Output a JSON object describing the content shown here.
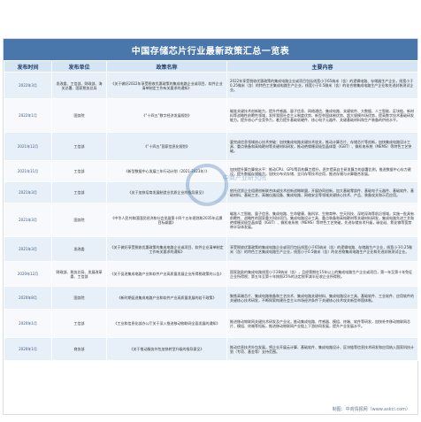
{
  "title": "中国存储芯片行业最新政策汇总一览表",
  "headers": [
    "发布时间",
    "发布单位",
    "政策名称",
    "主要内容"
  ],
  "rows": [
    {
      "time": "2022年3月",
      "unit": "发改委、工信部、财政部、海关总署、国家税务总局",
      "policy": "《关于做好2022年享受税收优惠政策的集成电路企业或项目、软件企业清单制定工作有关要求的通知》",
      "content": "2022年享受税收优惠政策的集成电路企业或项目包括线宽小于65纳米（含）的逻辑电路、存储器生产企业，线宽小于0.25微米（含）的特色工艺集成电路生产企业，线宽小于0.5微米（含）的化合物集成电路生产企业和先进封装测试企业。"
    },
    {
      "time": "2022年1月",
      "unit": "国务院",
      "policy": "《“十四五”数字经济发展规划》",
      "content": "瞄准关键技术创新能力，提升传感器、量子信息、网络通信、集成电路、关键软件、大数据、人工智能、区块链、新材料等战略性前瞻性领域，发挥我国社会主义制度优势、新型举国体制优势、超大规模市场优势，提高数字技术基础研发能力。提升核心产业竞争力，着力提升基础软硬件、核心电子元器件、关键基础材料和生产装备的供给水平。"
    },
    {
      "time": "2021年12月",
      "unit": "工信部",
      "policy": "《“十四五”国家信息化规划》",
      "content": "要完成信息领域核心技术突破：加快集成电路关键技术攻关，推动计算芯片、存储芯片等创新，加快集成电路设计工具、重点装备和高纯靶材等关键材料研发，推动绝缘栅双极型晶体管（IGBT）、微机电系统（MEMS）等特色工艺突破。"
    },
    {
      "time": "2021年11月",
      "unit": "工信部",
      "policy": "《新型数据中心发展三年行动计划（2021-2023年）》",
      "content": "加快提升算力算效水平：推动CPU、GPU等异构算力提升，逐步提高自主研发算力的部署比例，推进数据中心存力建设，提升数据存储能力，加快分布式存储、全闪存等技术应用，推进存储与计算融合发展。"
    },
    {
      "time": "2021年3月",
      "unit": "工信部",
      "policy": "《关于加快培育发展制造业优质企业的指导意见》",
      "content": "依托优质企业组建创新联合体或技术创新战略联盟，开展协同创新，加大基础零部件、基础电子元器件、基础软件、基础材料、基础工艺、高端仪器设备、集成电路、网络安全等领域关键核心技术、产品、装备攻关和示范应用。"
    },
    {
      "time": "2021年3月",
      "unit": "国务院",
      "policy": "《中华人民共和国国民经济和社会发展第十四个五年规划和2035年远景目标纲要》",
      "content": "瞄准人工智能、量子信息、集成电路、生命健康、脑科学、生物育种、空天科技、深地深海等前沿领域，实施一批具有前瞻性、战略性的国家重大科技项目。集成电路设计工具、重点装备和高纯靶材等关键材料研发，集成电路先进工艺和绝缘栅双极型晶体管（IGBT）、微机电系统（MEMS）等特色工艺突破，先进存储技术升级，碳化硅、氮化镓等宽禁带半导体发展。"
    },
    {
      "time": "2021年3月",
      "unit": "发改委",
      "policy": "《关于做好享受税收优惠政策的集成电路企业或项目、软件企业清单制定工作有关要求的通知》",
      "content": "享受税收优惠政策的集成电路企业或项目包括线宽小于65纳米（含）的逻辑电路、存储器生产企业，线宽小于0.25微米（含）的特色工艺集成电路生产企业，线宽小于0.5微米（含）的化合物集成电路生产企业和先进封装测试企业。"
    },
    {
      "time": "2020年12月",
      "unit": "财政部、税务总局、发展改革委、工信部",
      "policy": "《关于促进集成电路产业和软件产业高质量发展企业所得税政策的公告》",
      "content": "国家鼓励的集成电路线宽小于28纳米（含），且经营期在15年以上的集成电路生产企业或项目，第一年至第十年免征企业所得税；第五年至第十年按照25%的法定税率减半征收企业所得税。"
    },
    {
      "time": "2020年8月",
      "unit": "国务院",
      "policy": "《新时期促进集成电路产业和软件产业高质量发展的若干政策》",
      "content": "聚焦高端芯片、集成电路装备和工艺技术、集成电路关键材料、集成电路设计工具、基础软件、工业软件、应用软件的关键核心技术研发，不断探索构建社会主义市场经济条件下关键核心技术攻关新型举国体制。"
    },
    {
      "time": "2020年1月",
      "unit": "工信部",
      "policy": "《工业和信息化部办公厅关于深入推进移动物联网全面发展的通知》",
      "content": "推进移动物联网关键技术研发及产业化，推动集成电路、传感器、模组、终端、软件等研发，加快补齐移动物联网芯片、模组、终端等短板，推进移动物联网产业链上下游协同发展，提升产业发展水平。"
    },
    {
      "time": "2020年1月",
      "unit": "商务部",
      "policy": "《关于推动服务外包加快转型升级的指导意见》",
      "content": "推动信息技术外包发展，将企业开展云计算、基础软件、集成电路设计、区块链等信息技术研发和应用纳入国家科技计划（专项、基金等）支持范围。"
    }
  ],
  "source": "资料来源：中商产业研究院整理",
  "footer": "制图：中商情报网（www.askci.com）",
  "watermark": "中商产业研究院"
}
